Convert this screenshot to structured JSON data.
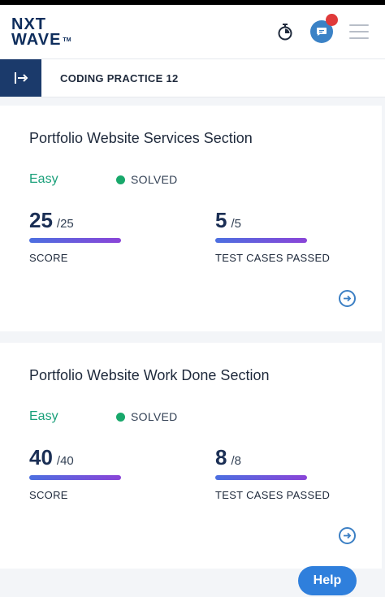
{
  "app": {
    "logo_line1": "NXT",
    "logo_line2": "WAVE",
    "logo_tm": "TM"
  },
  "subheader": {
    "title": "CODING PRACTICE 12"
  },
  "cards": [
    {
      "title": "Portfolio Website Services Section",
      "difficulty": "Easy",
      "status": "SOLVED",
      "score": "25",
      "score_total": "/25",
      "score_label": "SCORE",
      "tests": "5",
      "tests_total": "/5",
      "tests_label": "TEST CASES PASSED"
    },
    {
      "title": "Portfolio Website Work Done Section",
      "difficulty": "Easy",
      "status": "SOLVED",
      "score": "40",
      "score_total": "/40",
      "score_label": "SCORE",
      "tests": "8",
      "tests_total": "/8",
      "tests_label": "TEST CASES PASSED"
    }
  ],
  "help": {
    "label": "Help"
  },
  "colors": {
    "brand_navy": "#1b3a6b",
    "easy_green": "#1aa07a",
    "solved_dot": "#18a86b",
    "help_blue": "#2f7fdc",
    "notification_red": "#e03a3a"
  },
  "icons": [
    "timer-icon",
    "chat-icon",
    "menu-icon",
    "sidebar-expand-icon",
    "arrow-right-circle-icon"
  ]
}
